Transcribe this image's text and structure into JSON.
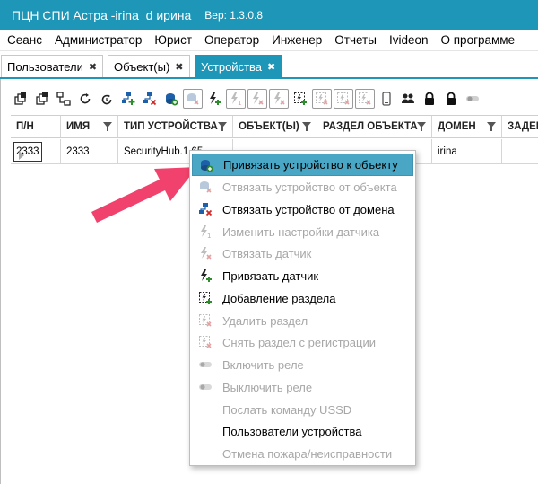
{
  "title": {
    "app": "ПЦН СПИ Астра -irina_d ирина",
    "version": "Вер: 1.3.0.8"
  },
  "menu": [
    "Сеанс",
    "Администратор",
    "Юрист",
    "Оператор",
    "Инженер",
    "Отчеты",
    "Ivideon",
    "О программе"
  ],
  "tabs": [
    {
      "label": "Пользователи",
      "close": "✖"
    },
    {
      "label": "Объект(ы)",
      "close": "✖"
    },
    {
      "label": "Устройства",
      "close": "✖",
      "active": true
    }
  ],
  "toolbar": {
    "icons": [
      "collapse-icon",
      "expand-icon",
      "network-icon",
      "refresh-icon",
      "timer-refresh-icon",
      "bind-domain-icon",
      "unbind-domain-icon",
      "bind-object-icon",
      "unbind-object-icon",
      "sensor-add-icon",
      "sensor-settings-icon",
      "sensor-remove-icon",
      "section-add-icon",
      "section-delete-icon",
      "section-unregister-icon",
      "section-disabled-icon",
      "phone-icon",
      "users-icon",
      "lock-icon",
      "lock-icon",
      "toggle-icon"
    ]
  },
  "grid": {
    "columns": [
      "П/Н",
      "ИМЯ",
      "ТИП УСТРОЙСТВА",
      "ОБЪЕКТ(Ы)",
      "РАЗДЕЛ ОБЪЕКТА",
      "ДОМЕН",
      "ЗАДЕР"
    ],
    "row": {
      "pn": "2333",
      "name": "2333",
      "type": "SecurityHub.1.65",
      "object": "",
      "section": "",
      "domain": "irina",
      "delay": ""
    }
  },
  "context_menu": {
    "items": [
      {
        "label": "Привязать устройство к объекту",
        "icon": "bind-object-icon",
        "enabled": true,
        "highlighted": true
      },
      {
        "label": "Отвязать устройство от объекта",
        "icon": "unbind-object-icon",
        "enabled": false
      },
      {
        "label": "Отвязать устройство от домена",
        "icon": "unbind-domain-icon",
        "enabled": true
      },
      {
        "label": "Изменить настройки датчика",
        "icon": "sensor-settings-icon",
        "enabled": false
      },
      {
        "label": "Отвязать датчик",
        "icon": "sensor-remove-icon",
        "enabled": false
      },
      {
        "label": "Привязать датчик",
        "icon": "sensor-add-icon",
        "enabled": true
      },
      {
        "label": "Добавление раздела",
        "icon": "section-add-icon",
        "enabled": true
      },
      {
        "label": "Удалить раздел",
        "icon": "section-delete-icon",
        "enabled": false
      },
      {
        "label": "Снять раздел с регистрации",
        "icon": "section-unregister-icon",
        "enabled": false
      },
      {
        "label": "Включить реле",
        "icon": "relay-on-icon",
        "enabled": false
      },
      {
        "label": "Выключить реле",
        "icon": "relay-off-icon",
        "enabled": false
      },
      {
        "label": "Послать команду USSD",
        "icon": "",
        "enabled": false
      },
      {
        "label": "Пользователи устройства",
        "icon": "",
        "enabled": true
      },
      {
        "label": "Отмена пожара/неисправности",
        "icon": "",
        "enabled": false
      }
    ]
  },
  "colors": {
    "accent": "#1e96b7",
    "highlight": "#4aa6c5",
    "arrow": "#f0426c",
    "disabled": "#a7a7a7"
  }
}
